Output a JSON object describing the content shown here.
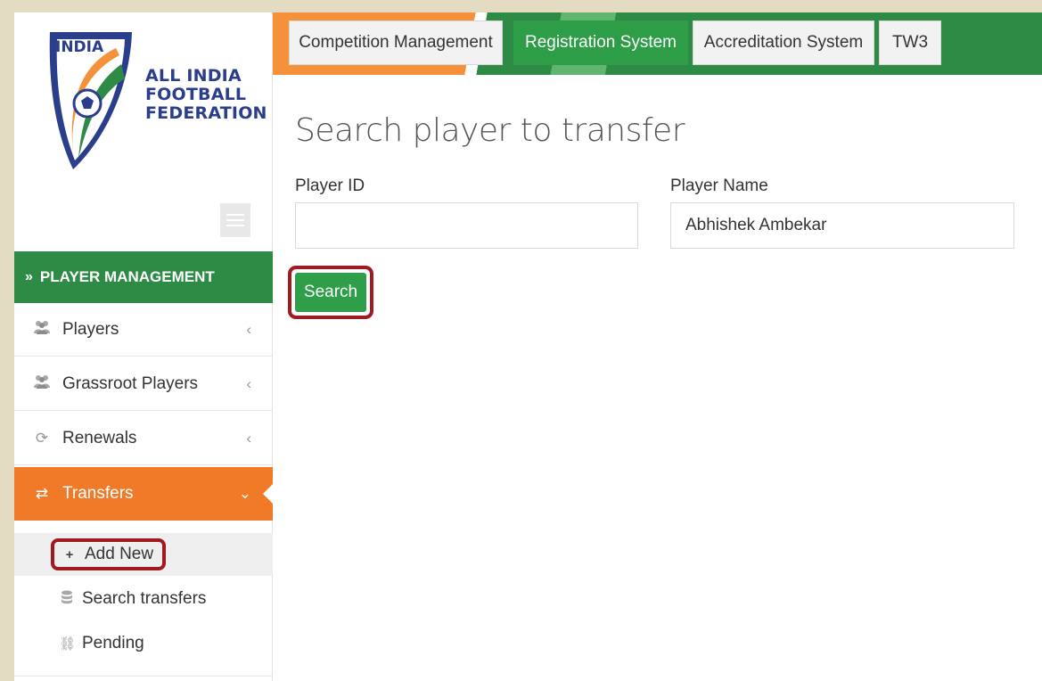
{
  "logo": {
    "shield_text": "INDIA",
    "line1": "ALL INDIA",
    "line2": "FOOTBALL",
    "line3": "FEDERATION"
  },
  "sidebar": {
    "section_title": "PLAYER MANAGEMENT",
    "items": [
      {
        "label": "Players",
        "icon": "users-icon"
      },
      {
        "label": "Grassroot Players",
        "icon": "users-icon"
      },
      {
        "label": "Renewals",
        "icon": "refresh-icon"
      },
      {
        "label": "Transfers",
        "icon": "exchange-icon",
        "active": true
      }
    ],
    "subitems": [
      {
        "label": "Add New",
        "icon": "plus-icon"
      },
      {
        "label": "Search transfers",
        "icon": "database-icon"
      },
      {
        "label": "Pending",
        "icon": "chain-broken-icon"
      }
    ]
  },
  "tabs": [
    {
      "label": "Competition Management"
    },
    {
      "label": "Registration System",
      "active": true
    },
    {
      "label": "Accreditation System"
    },
    {
      "label": "TW3"
    }
  ],
  "main": {
    "title": "Search player to transfer",
    "player_id_label": "Player ID",
    "player_id_value": "",
    "player_name_label": "Player Name",
    "player_name_value": "Abhishek Ambekar",
    "search_label": "Search"
  },
  "colors": {
    "green": "#2e8b45",
    "orange": "#f07a28",
    "highlight_red": "#a01a1f",
    "navy": "#2b3e8c"
  }
}
